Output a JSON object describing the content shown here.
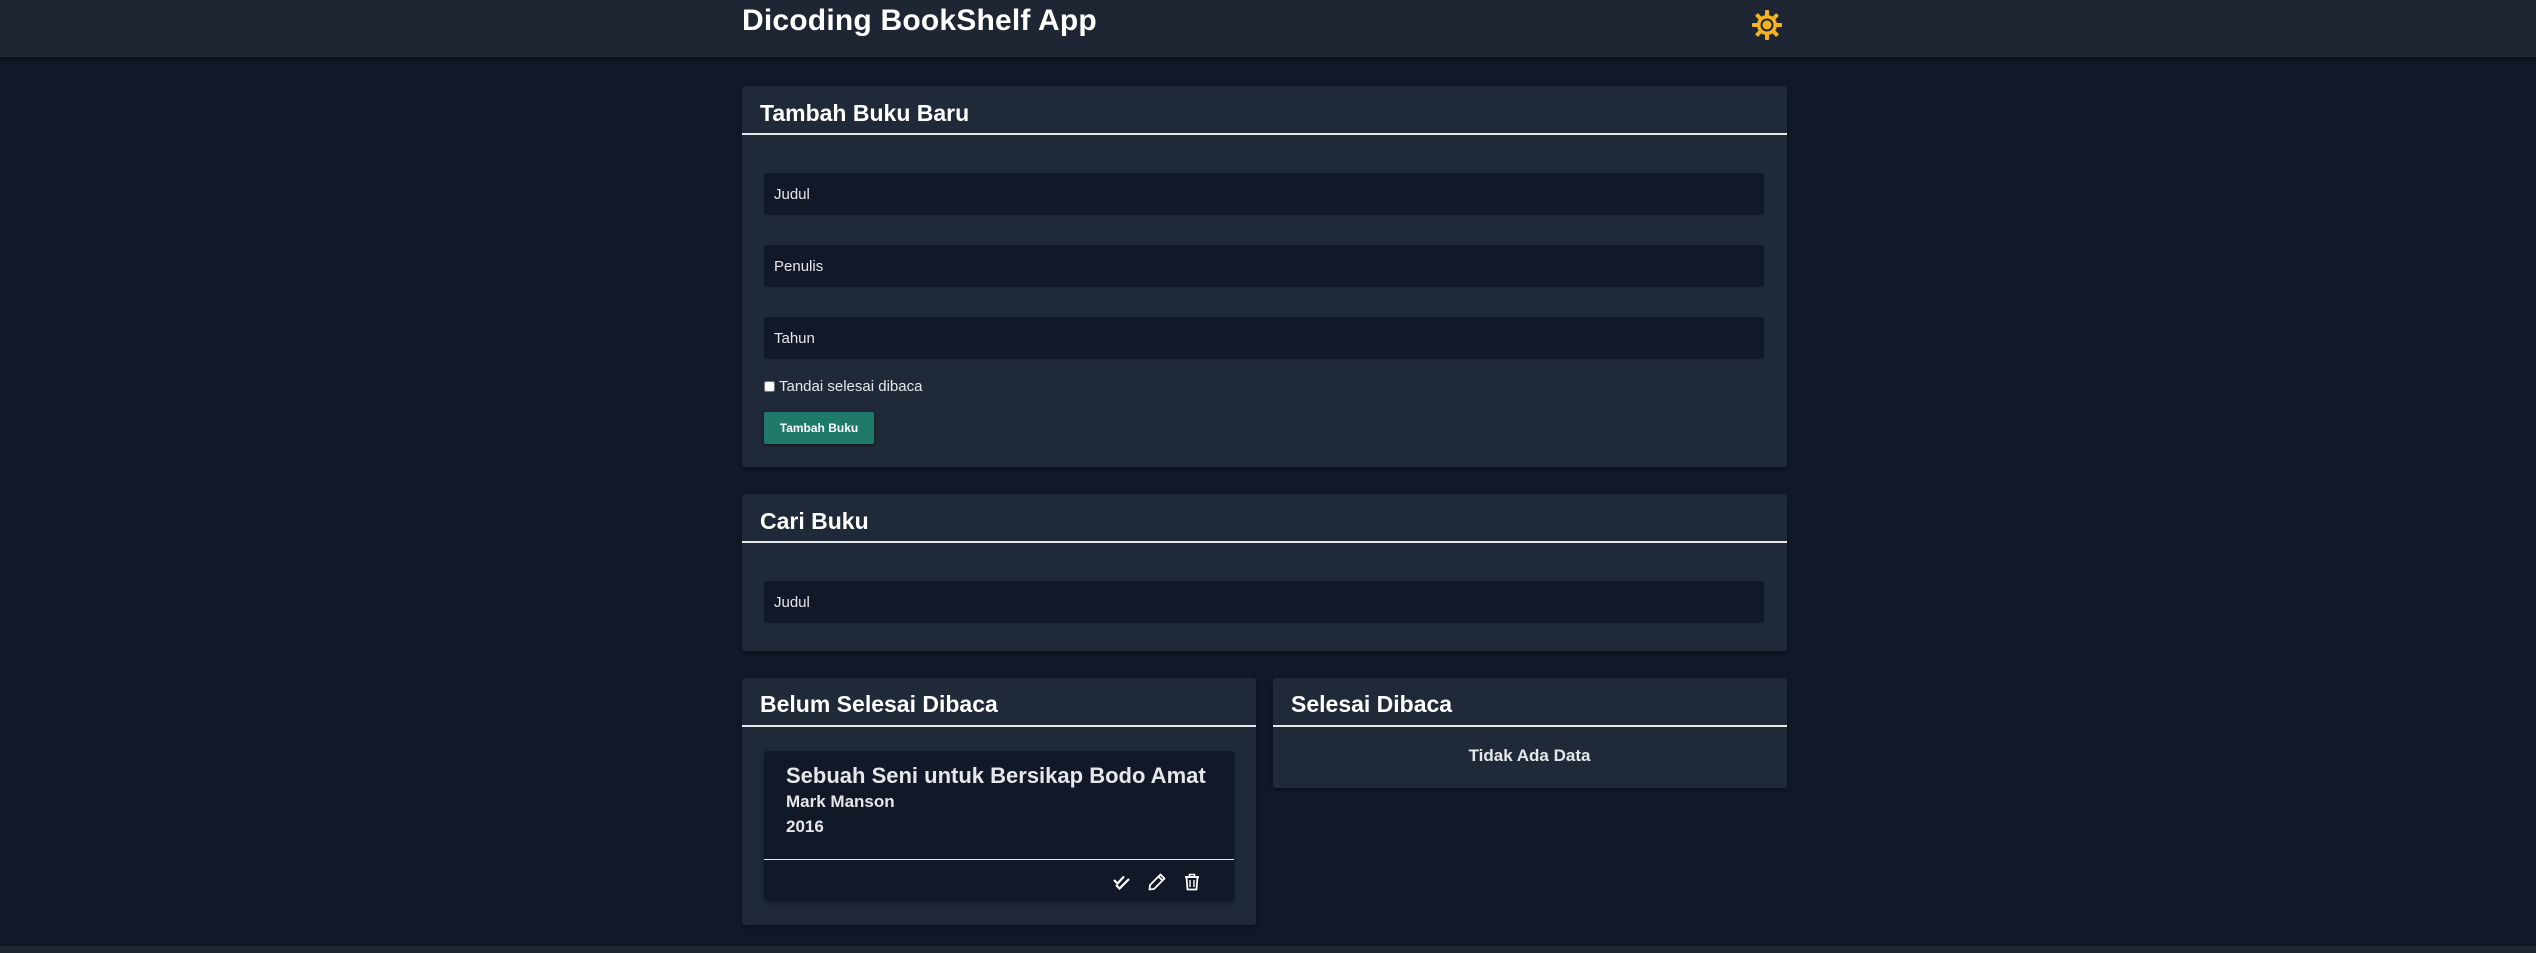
{
  "header": {
    "app_title": "Dicoding BookShelf App",
    "theme_icon": "sun-gear-icon"
  },
  "add_form": {
    "title": "Tambah Buku Baru",
    "title_placeholder": "Judul",
    "author_placeholder": "Penulis",
    "year_placeholder": "Tahun",
    "finished_label": "Tandai selesai dibaca",
    "finished_checked": false,
    "submit_label": "Tambah Buku"
  },
  "search": {
    "title": "Cari Buku",
    "placeholder": "Judul"
  },
  "unfinished_shelf": {
    "title": "Belum Selesai Dibaca",
    "books": [
      {
        "title": "Sebuah Seni untuk Bersikap Bodo Amat",
        "author": "Mark Manson",
        "year": "2016",
        "actions": [
          "double-check-icon",
          "pencil-icon",
          "trash-icon"
        ]
      }
    ]
  },
  "finished_shelf": {
    "title": "Selesai Dibaca",
    "empty_text": "Tidak Ada Data"
  },
  "colors": {
    "background": "#111827",
    "panel": "#1f2937",
    "accent": "#1f7a6c",
    "icon_sun": "#f5b321"
  }
}
